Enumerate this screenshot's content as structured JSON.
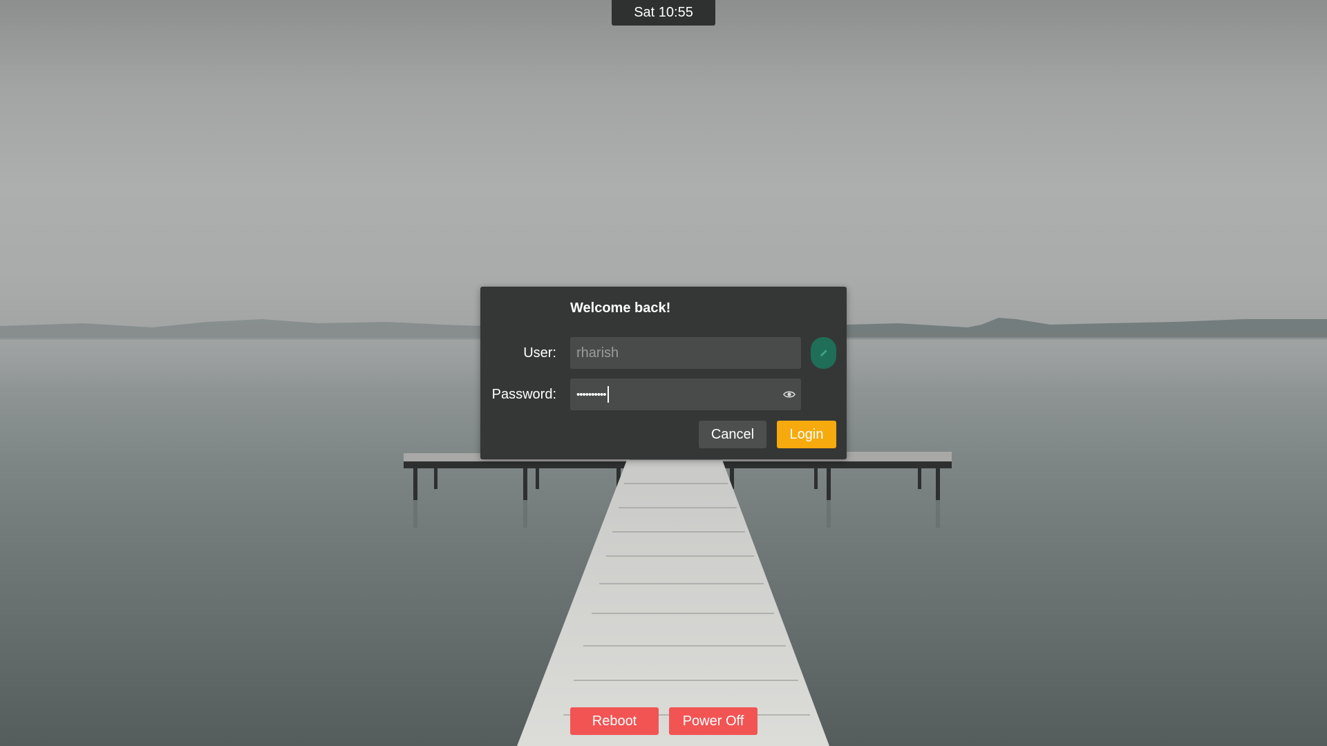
{
  "topbar": {
    "clock": "Sat 10:55"
  },
  "dialog": {
    "title": "Welcome back!",
    "user_label": "User:",
    "user_value": "rharish",
    "password_label": "Password:",
    "password_masked": "••••••••••",
    "cancel_label": "Cancel",
    "login_label": "Login"
  },
  "power": {
    "reboot_label": "Reboot",
    "poweroff_label": "Power Off"
  },
  "icons": {
    "edit": "pencil-icon",
    "reveal_password": "eye-icon"
  },
  "colors": {
    "login_accent": "#f6aa0d",
    "danger": "#f25454",
    "edit_accent": "#1f6e57"
  }
}
